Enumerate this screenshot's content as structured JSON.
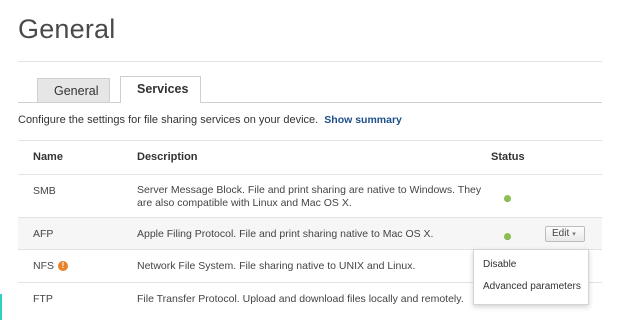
{
  "page": {
    "title": "General"
  },
  "tabs": [
    {
      "label": "General",
      "active": false
    },
    {
      "label": "Services",
      "active": true
    }
  ],
  "intro": {
    "text": "Configure the settings for file sharing services on your device.",
    "link": "Show summary"
  },
  "table": {
    "headers": {
      "name": "Name",
      "description": "Description",
      "status": "Status"
    },
    "rows": [
      {
        "name": "SMB",
        "description": "Server Message Block. File and print sharing are native to Windows. They are also compatible with Linux and Mac OS X.",
        "status": "enabled"
      },
      {
        "name": "AFP",
        "description": "Apple Filing Protocol. File and print sharing native to Mac OS X.",
        "status": "enabled",
        "edit_label": "Edit",
        "edit_chevron": "▾"
      },
      {
        "name": "NFS",
        "description": "Network File System. File sharing native to UNIX and Linux.",
        "warning_icon": "!"
      },
      {
        "name": "FTP",
        "description": "File Transfer Protocol. Upload and download files locally and remotely."
      }
    ]
  },
  "dropdown": {
    "items": [
      {
        "label": "Disable"
      },
      {
        "label": "Advanced parameters"
      }
    ]
  },
  "colors": {
    "accent": "#2fd0c4",
    "status_ok": "#8cc152",
    "warning": "#e8822a",
    "link": "#1f4f8a"
  },
  "icons": {
    "status": "status-dot-icon",
    "warning": "warning-icon",
    "edit_menu": "chevron-down-icon"
  }
}
